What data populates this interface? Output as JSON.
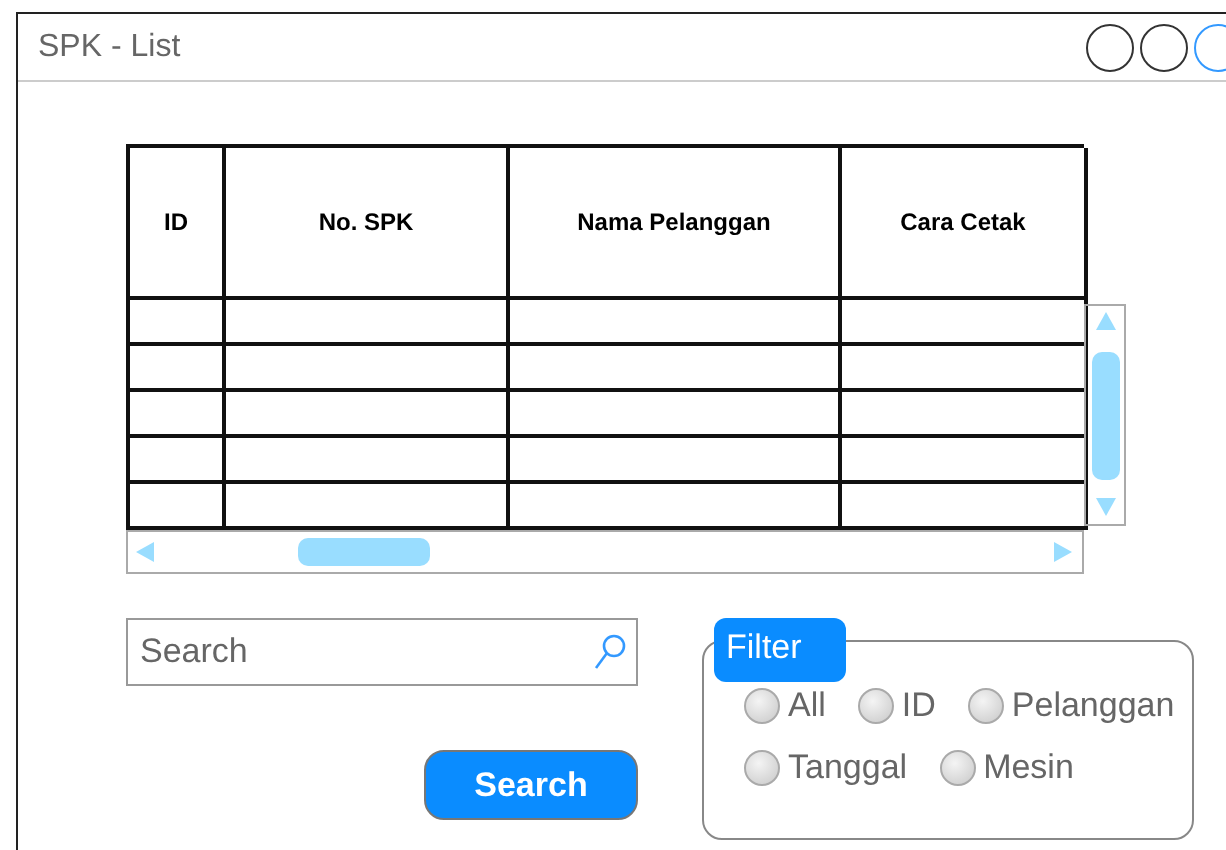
{
  "window": {
    "title": "SPK - List"
  },
  "table": {
    "columns": [
      "ID",
      "No. SPK",
      "Nama Pelanggan",
      "Cara Cetak"
    ]
  },
  "search": {
    "placeholder": "Search",
    "button": "Search"
  },
  "filter": {
    "title": "Filter",
    "rows": [
      {
        "options": [
          {
            "label": "All",
            "selected": false
          },
          {
            "label": "ID",
            "selected": false
          },
          {
            "label": "Pelanggan",
            "selected": false
          }
        ]
      },
      {
        "options": [
          {
            "label": "Tanggal",
            "selected": false
          },
          {
            "label": "Mesin",
            "selected": false
          }
        ]
      }
    ]
  }
}
